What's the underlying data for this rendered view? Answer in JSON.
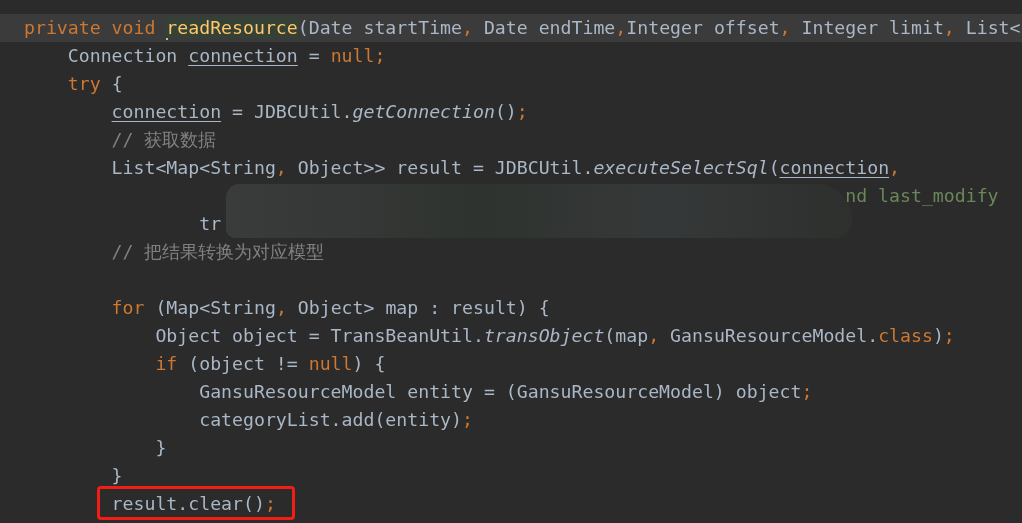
{
  "editor": {
    "lines": [
      {
        "current": true,
        "tokens": [
          {
            "text": "private void ",
            "kind": "keyword"
          },
          {
            "text": "readResource",
            "kind": "declaration",
            "caret": true,
            "highlighted": true
          },
          {
            "text": "(Date startTime",
            "kind": "plain"
          },
          {
            "text": ", ",
            "kind": "punct"
          },
          {
            "text": "Date endTime",
            "kind": "plain"
          },
          {
            "text": ",",
            "kind": "punct"
          },
          {
            "text": "Integer offset",
            "kind": "plain"
          },
          {
            "text": ", ",
            "kind": "punct"
          },
          {
            "text": "Integer limit",
            "kind": "plain"
          },
          {
            "text": ", ",
            "kind": "punct"
          },
          {
            "text": "List<",
            "kind": "plain"
          }
        ]
      },
      {
        "current": false,
        "tokens": [
          {
            "text": "    Connection ",
            "kind": "plain"
          },
          {
            "text": "connection",
            "kind": "variable"
          },
          {
            "text": " = ",
            "kind": "plain"
          },
          {
            "text": "null;",
            "kind": "keyword"
          }
        ]
      },
      {
        "current": false,
        "tokens": [
          {
            "text": "    try",
            "kind": "keyword"
          },
          {
            "text": " {",
            "kind": "plain"
          }
        ]
      },
      {
        "current": false,
        "tokens": [
          {
            "text": "        connection",
            "kind": "variable"
          },
          {
            "text": " = JDBCUtil.",
            "kind": "plain"
          },
          {
            "text": "getConnection",
            "kind": "static"
          },
          {
            "text": "()",
            "kind": "plain"
          },
          {
            "text": ";",
            "kind": "punct"
          }
        ]
      },
      {
        "current": false,
        "tokens": [
          {
            "text": "        // 获取数据",
            "kind": "comment"
          }
        ]
      },
      {
        "current": false,
        "tokens": [
          {
            "text": "        List<Map<String",
            "kind": "plain"
          },
          {
            "text": ", ",
            "kind": "punct"
          },
          {
            "text": "Object>> result = JDBCUtil.",
            "kind": "plain"
          },
          {
            "text": "executeSelectSql",
            "kind": "static"
          },
          {
            "text": "(",
            "kind": "plain"
          },
          {
            "text": "connection",
            "kind": "variable"
          },
          {
            "text": ",",
            "kind": "punct"
          }
        ]
      },
      {
        "current": false,
        "tokens": [
          {
            "text": "                                                                           nd last_modify",
            "kind": "string"
          }
        ]
      },
      {
        "current": false,
        "tokens": [
          {
            "text": "                tr",
            "kind": "plain"
          }
        ]
      },
      {
        "current": false,
        "tokens": [
          {
            "text": "        // 把结果转换为对应模型",
            "kind": "comment"
          }
        ]
      },
      {
        "current": false
      },
      {
        "current": false,
        "tokens": [
          {
            "text": "        for",
            "kind": "keyword"
          },
          {
            "text": " (Map<String",
            "kind": "plain"
          },
          {
            "text": ", ",
            "kind": "punct"
          },
          {
            "text": "Object> map : result) {",
            "kind": "plain"
          }
        ]
      },
      {
        "current": false,
        "tokens": [
          {
            "text": "            Object object = TransBeanUtil.",
            "kind": "plain"
          },
          {
            "text": "transObject",
            "kind": "static"
          },
          {
            "text": "(map",
            "kind": "plain"
          },
          {
            "text": ", ",
            "kind": "punct"
          },
          {
            "text": "GansuResourceModel.",
            "kind": "plain"
          },
          {
            "text": "class",
            "kind": "keyword"
          },
          {
            "text": ")",
            "kind": "plain"
          },
          {
            "text": ";",
            "kind": "punct"
          }
        ]
      },
      {
        "current": false,
        "tokens": [
          {
            "text": "            if",
            "kind": "keyword"
          },
          {
            "text": " (object != ",
            "kind": "plain"
          },
          {
            "text": "null",
            "kind": "keyword"
          },
          {
            "text": ") {",
            "kind": "plain"
          }
        ]
      },
      {
        "current": false,
        "tokens": [
          {
            "text": "                GansuResourceModel entity = (GansuResourceModel) object",
            "kind": "plain"
          },
          {
            "text": ";",
            "kind": "punct"
          }
        ]
      },
      {
        "current": false,
        "tokens": [
          {
            "text": "                categoryList.add(entity)",
            "kind": "plain"
          },
          {
            "text": ";",
            "kind": "punct"
          }
        ]
      },
      {
        "current": false,
        "tokens": [
          {
            "text": "            }",
            "kind": "plain"
          }
        ]
      },
      {
        "current": false,
        "tokens": [
          {
            "text": "        }",
            "kind": "plain"
          }
        ]
      },
      {
        "current": false,
        "boxed": true,
        "tokens": [
          {
            "text": "        result.clear()",
            "kind": "plain"
          },
          {
            "text": ";",
            "kind": "punct"
          }
        ]
      }
    ]
  }
}
